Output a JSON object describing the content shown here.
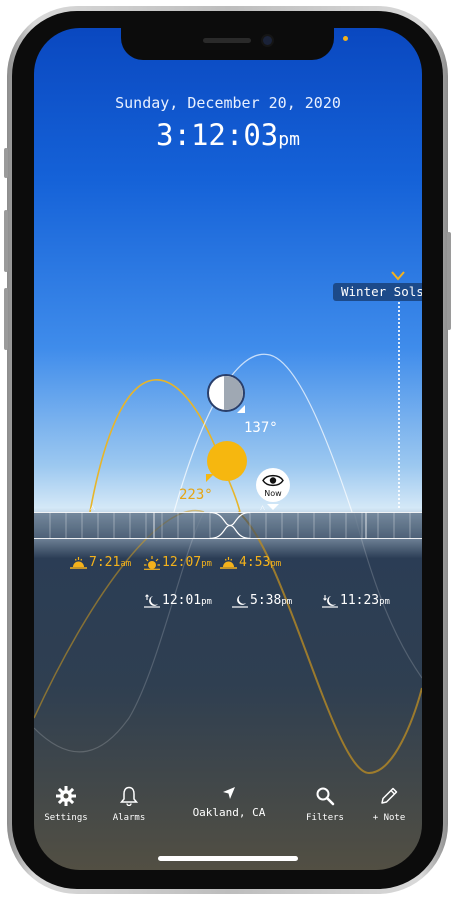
{
  "header": {
    "date": "Sunday, December 20, 2020",
    "time": "3:12:03",
    "time_ampm": "pm"
  },
  "event_marker": {
    "label": "Winter Sols"
  },
  "sky": {
    "moon_azimuth": "137°",
    "sun_azimuth": "223°",
    "now_label": "Now"
  },
  "sun_times": [
    {
      "kind": "sunrise",
      "time": "7:21",
      "unit": "am",
      "icon": "sunrise-icon"
    },
    {
      "kind": "solar-noon",
      "time": "12:07",
      "unit": "pm",
      "icon": "sun-icon"
    },
    {
      "kind": "sunset",
      "time": "4:53",
      "unit": "pm",
      "icon": "sunset-icon"
    }
  ],
  "moon_times": [
    {
      "kind": "moonrise",
      "time": "12:01",
      "unit": "pm",
      "icon": "moonrise-icon"
    },
    {
      "kind": "moon-transit",
      "time": "5:38",
      "unit": "pm",
      "icon": "moon-icon"
    },
    {
      "kind": "moonset",
      "time": "11:23",
      "unit": "pm",
      "icon": "moonset-icon"
    }
  ],
  "tabbar": {
    "settings": "Settings",
    "alarms": "Alarms",
    "location": "Oakland, CA",
    "filters": "Filters",
    "note": "+ Note"
  },
  "colors": {
    "sun": "#f6b70f",
    "sky_top": "#0a48c0",
    "ground": "#2f3f51"
  }
}
